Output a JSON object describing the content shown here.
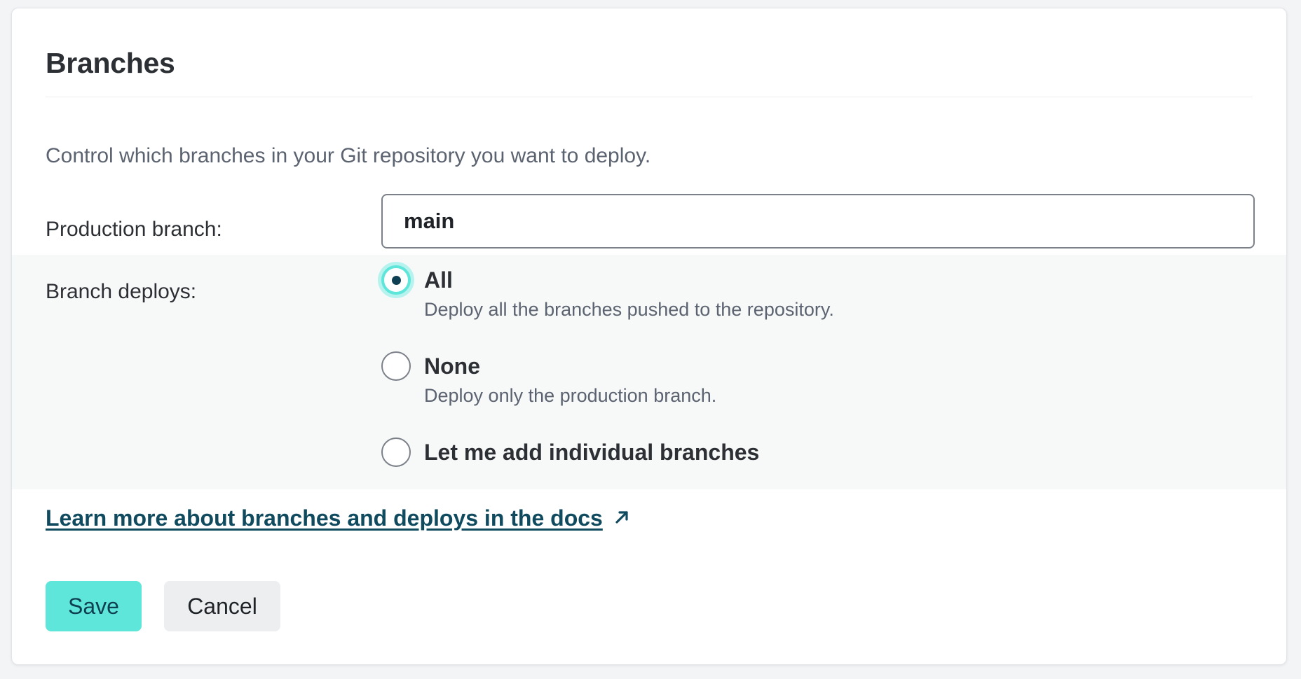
{
  "section": {
    "title": "Branches",
    "description": "Control which branches in your Git repository you want to deploy."
  },
  "production_branch": {
    "label": "Production branch:",
    "value": "main"
  },
  "branch_deploys": {
    "label": "Branch deploys:",
    "selected": "All",
    "options": [
      {
        "title": "All",
        "description": "Deploy all the branches pushed to the repository.",
        "checked": true
      },
      {
        "title": "None",
        "description": "Deploy only the production branch.",
        "checked": false
      },
      {
        "title": "Let me add individual branches",
        "description": "",
        "checked": false
      }
    ]
  },
  "docs_link": {
    "text": "Learn more about branches and deploys in the docs",
    "icon": "external-link-arrow-icon"
  },
  "actions": {
    "save_label": "Save",
    "cancel_label": "Cancel"
  },
  "colors": {
    "accent": "#5de6d9",
    "accent_dark": "#0f3f52",
    "link": "#0f4a5f",
    "band_background": "#f7f8f8"
  }
}
